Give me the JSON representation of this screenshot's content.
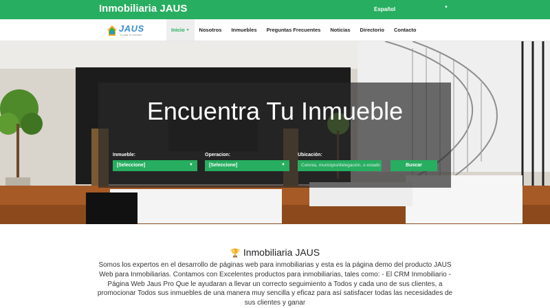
{
  "topbar": {
    "site_title": "Inmobiliaria JAUS",
    "language": "Español"
  },
  "navbar": {
    "logo_text": "JAUS",
    "logo_tagline": "Tu casa, tu inversion",
    "items": [
      {
        "label": "Inicio",
        "active": true
      },
      {
        "label": "Nosotros"
      },
      {
        "label": "Inmuebles"
      },
      {
        "label": "Preguntas Frecuentes"
      },
      {
        "label": "Noticias"
      },
      {
        "label": "Directorio"
      },
      {
        "label": "Contacto"
      }
    ]
  },
  "hero": {
    "title": "Encuentra Tu Inmueble",
    "filters": {
      "inmueble_label": "Inmueble:",
      "inmueble_value": "[Seleccione]",
      "operacion_label": "Operacion:",
      "operacion_value": "[Seleccione]",
      "ubicacion_label": "Ubicación:",
      "ubicacion_placeholder": "Colonia, municipio/delegación, o estado",
      "search_label": "Buscar"
    }
  },
  "about": {
    "title": "Inmobiliaria JAUS",
    "text": "Somos los expertos en el desarrollo de páginas web para inmobiliarias y esta es la página demo del producto JAUS Web para Inmobiliarias. Contamos con Excelentes productos para inmobiliarias, tales como: - El CRM Inmobiliario - Página Web Jaus Pro Que le ayudaran a llevar un correcto seguimiento a Todos y cada uno de sus clientes, a promocionar Todos sus inmuebles de una manera muy sencilla y eficaz para así satisfacer todas las necesidades de sus clientes y ganar"
  },
  "colors": {
    "brand_green": "#27ae60",
    "logo_blue": "#3a8fd0"
  }
}
